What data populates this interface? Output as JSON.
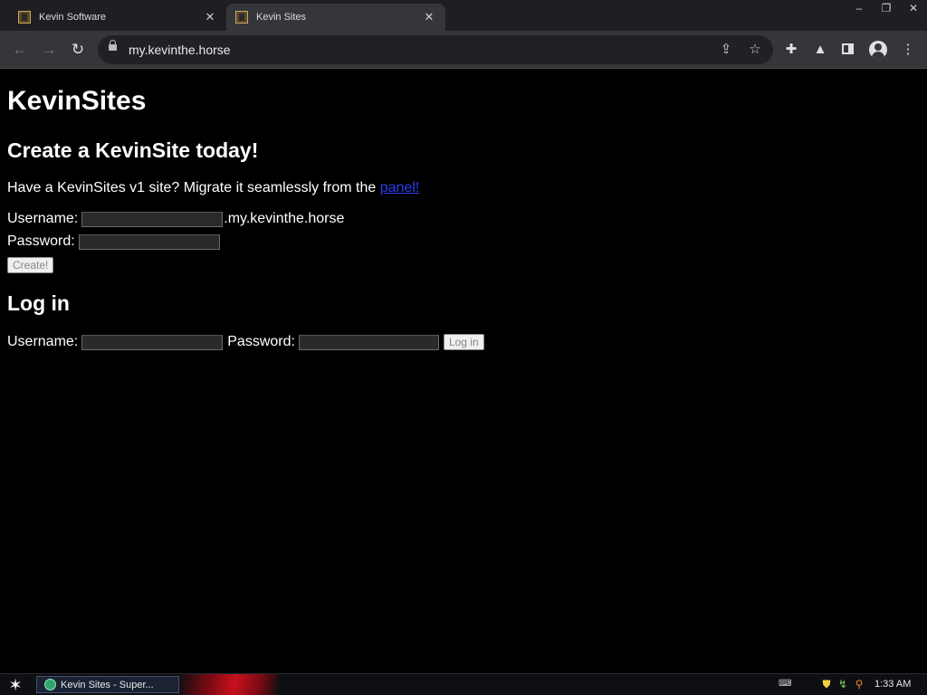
{
  "browser": {
    "tabs": [
      {
        "title": "Kevin Software",
        "active": false
      },
      {
        "title": "Kevin Sites",
        "active": true
      }
    ],
    "url": "my.kevinthe.horse"
  },
  "page": {
    "heading": "KevinSites",
    "create_heading": "Create a KevinSite today!",
    "migrate_text": "Have a KevinSites v1 site? Migrate it seamlessly from the ",
    "migrate_link": "panel!",
    "create_form": {
      "username_label": "Username:",
      "domain_suffix": ".my.kevinthe.horse",
      "password_label": "Password:",
      "submit_label": "Create!"
    },
    "login_heading": "Log in",
    "login_form": {
      "username_label": "Username:",
      "password_label": "Password:",
      "submit_label": "Log in"
    }
  },
  "taskbar": {
    "task_label": "Kevin Sites - Super...",
    "clock": "1:33 AM"
  }
}
